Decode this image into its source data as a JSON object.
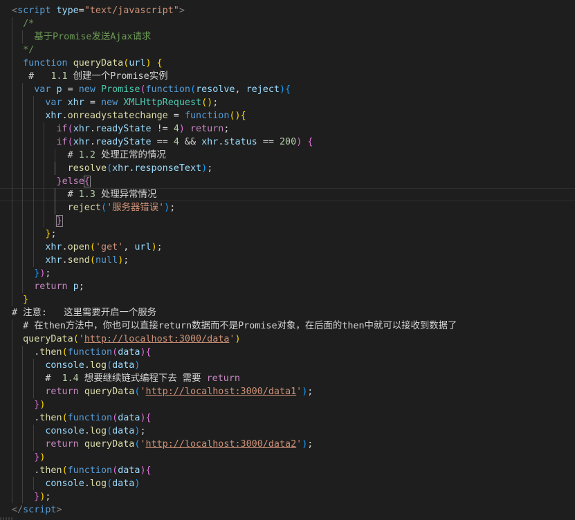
{
  "editor": {
    "colors": {
      "background": "#1e1e1e",
      "plain": "#d4d4d4",
      "keyword": "#569cd6",
      "control": "#c586c0",
      "function": "#dcdcaa",
      "variable": "#9cdcfe",
      "string": "#ce9178",
      "number": "#b5cea8",
      "comment": "#6a9955",
      "class": "#4ec9b0",
      "tag": "#569cd6",
      "tag_bracket": "#808080",
      "property": "#9cdcfe",
      "brace1": "#ffd700",
      "brace2": "#da70d6",
      "brace3": "#179fff"
    },
    "lines": [
      {
        "guides": 0,
        "tokens": [
          [
            "<",
            "tag_bracket"
          ],
          [
            "script",
            "tag"
          ],
          [
            " ",
            "plain"
          ],
          [
            "type",
            "variable"
          ],
          [
            "=",
            "plain"
          ],
          [
            "\"text/javascript\"",
            "string"
          ],
          [
            ">",
            "tag_bracket"
          ]
        ]
      },
      {
        "guides": 1,
        "tokens": [
          [
            "  /*",
            "comment"
          ]
        ]
      },
      {
        "guides": 2,
        "tokens": [
          [
            "    基于Promise发送Ajax请求",
            "comment"
          ]
        ]
      },
      {
        "guides": 1,
        "tokens": [
          [
            "  */",
            "comment"
          ]
        ]
      },
      {
        "guides": 1,
        "tokens": [
          [
            "  ",
            "plain"
          ],
          [
            "function",
            "keyword"
          ],
          [
            " ",
            "plain"
          ],
          [
            "queryData",
            "function"
          ],
          [
            "(",
            "brace1"
          ],
          [
            "url",
            "variable"
          ],
          [
            ")",
            "brace1"
          ],
          [
            " ",
            "plain"
          ],
          [
            "{",
            "brace1"
          ]
        ]
      },
      {
        "guides": 1,
        "tokens": [
          [
            "   #   ",
            "plain"
          ],
          [
            "1.1",
            "number"
          ],
          [
            " 创建一个",
            "plain"
          ],
          [
            "Promise",
            "plain"
          ],
          [
            "实例",
            "plain"
          ]
        ]
      },
      {
        "guides": 2,
        "tokens": [
          [
            "    ",
            "plain"
          ],
          [
            "var",
            "keyword"
          ],
          [
            " ",
            "plain"
          ],
          [
            "p",
            "variable"
          ],
          [
            " = ",
            "plain"
          ],
          [
            "new",
            "keyword"
          ],
          [
            " ",
            "plain"
          ],
          [
            "Promise",
            "class"
          ],
          [
            "(",
            "brace2"
          ],
          [
            "function",
            "keyword"
          ],
          [
            "(",
            "brace3"
          ],
          [
            "resolve",
            "variable"
          ],
          [
            ", ",
            "plain"
          ],
          [
            "reject",
            "variable"
          ],
          [
            ")",
            "brace3"
          ],
          [
            "{",
            "brace3"
          ]
        ]
      },
      {
        "guides": 3,
        "tokens": [
          [
            "      ",
            "plain"
          ],
          [
            "var",
            "keyword"
          ],
          [
            " ",
            "plain"
          ],
          [
            "xhr",
            "variable"
          ],
          [
            " = ",
            "plain"
          ],
          [
            "new",
            "keyword"
          ],
          [
            " ",
            "plain"
          ],
          [
            "XMLHttpRequest",
            "class"
          ],
          [
            "()",
            "brace1"
          ],
          [
            ";",
            "plain"
          ]
        ]
      },
      {
        "guides": 3,
        "tokens": [
          [
            "      ",
            "plain"
          ],
          [
            "xhr",
            "variable"
          ],
          [
            ".",
            "plain"
          ],
          [
            "onreadystatechange",
            "function"
          ],
          [
            " = ",
            "plain"
          ],
          [
            "function",
            "keyword"
          ],
          [
            "(){",
            "brace1"
          ]
        ]
      },
      {
        "guides": 4,
        "tokens": [
          [
            "        ",
            "plain"
          ],
          [
            "if",
            "control"
          ],
          [
            "(",
            "brace2"
          ],
          [
            "xhr",
            "variable"
          ],
          [
            ".",
            "plain"
          ],
          [
            "readyState",
            "property"
          ],
          [
            " != ",
            "plain"
          ],
          [
            "4",
            "number"
          ],
          [
            ")",
            "brace2"
          ],
          [
            " ",
            "plain"
          ],
          [
            "return",
            "control"
          ],
          [
            ";",
            "plain"
          ]
        ]
      },
      {
        "guides": 4,
        "tokens": [
          [
            "        ",
            "plain"
          ],
          [
            "if",
            "control"
          ],
          [
            "(",
            "brace2"
          ],
          [
            "xhr",
            "variable"
          ],
          [
            ".",
            "plain"
          ],
          [
            "readyState",
            "property"
          ],
          [
            " == ",
            "plain"
          ],
          [
            "4",
            "number"
          ],
          [
            " && ",
            "plain"
          ],
          [
            "xhr",
            "variable"
          ],
          [
            ".",
            "plain"
          ],
          [
            "status",
            "property"
          ],
          [
            " == ",
            "plain"
          ],
          [
            "200",
            "number"
          ],
          [
            ")",
            "brace2"
          ],
          [
            " ",
            "plain"
          ],
          [
            "{",
            "brace2"
          ]
        ]
      },
      {
        "guides": 5,
        "tokens": [
          [
            "          # ",
            "plain"
          ],
          [
            "1.2",
            "number"
          ],
          [
            " 处理正常的情况",
            "plain"
          ]
        ]
      },
      {
        "guides": 5,
        "tokens": [
          [
            "          ",
            "plain"
          ],
          [
            "resolve",
            "function"
          ],
          [
            "(",
            "brace3"
          ],
          [
            "xhr",
            "variable"
          ],
          [
            ".",
            "plain"
          ],
          [
            "responseText",
            "property"
          ],
          [
            ")",
            "brace3"
          ],
          [
            ";",
            "plain"
          ]
        ]
      },
      {
        "guides": 4,
        "tokens": [
          [
            "        ",
            "plain"
          ],
          [
            "}",
            "brace2"
          ],
          [
            "else",
            "control"
          ],
          [
            "{",
            "brace2",
            "box"
          ]
        ]
      },
      {
        "guides": 5,
        "current": true,
        "tokens": [
          [
            "          # ",
            "plain"
          ],
          [
            "1.3",
            "number"
          ],
          [
            " 处理异常情况",
            "plain"
          ]
        ]
      },
      {
        "guides": 5,
        "tokens": [
          [
            "          ",
            "plain"
          ],
          [
            "reject",
            "function"
          ],
          [
            "(",
            "brace3"
          ],
          [
            "'服务器错误'",
            "string"
          ],
          [
            ")",
            "brace3"
          ],
          [
            ";",
            "plain"
          ]
        ]
      },
      {
        "guides": 5,
        "tokens": [
          [
            "        ",
            "plain"
          ],
          [
            "}",
            "brace2",
            "box"
          ]
        ]
      },
      {
        "guides": 3,
        "tokens": [
          [
            "      ",
            "plain"
          ],
          [
            "}",
            "brace1"
          ],
          [
            ";",
            "plain"
          ]
        ]
      },
      {
        "guides": 3,
        "tokens": [
          [
            "      ",
            "plain"
          ],
          [
            "xhr",
            "variable"
          ],
          [
            ".",
            "plain"
          ],
          [
            "open",
            "function"
          ],
          [
            "(",
            "brace1"
          ],
          [
            "'get'",
            "string"
          ],
          [
            ", ",
            "plain"
          ],
          [
            "url",
            "variable"
          ],
          [
            ")",
            "brace1"
          ],
          [
            ";",
            "plain"
          ]
        ]
      },
      {
        "guides": 3,
        "tokens": [
          [
            "      ",
            "plain"
          ],
          [
            "xhr",
            "variable"
          ],
          [
            ".",
            "plain"
          ],
          [
            "send",
            "function"
          ],
          [
            "(",
            "brace1"
          ],
          [
            "null",
            "keyword"
          ],
          [
            ")",
            "brace1"
          ],
          [
            ";",
            "plain"
          ]
        ]
      },
      {
        "guides": 2,
        "tokens": [
          [
            "    ",
            "plain"
          ],
          [
            "}",
            "brace3"
          ],
          [
            ")",
            "brace2"
          ],
          [
            ";",
            "plain"
          ]
        ]
      },
      {
        "guides": 2,
        "tokens": [
          [
            "    ",
            "plain"
          ],
          [
            "return",
            "control"
          ],
          [
            " ",
            "plain"
          ],
          [
            "p",
            "variable"
          ],
          [
            ";",
            "plain"
          ]
        ]
      },
      {
        "guides": 1,
        "tokens": [
          [
            "  ",
            "plain"
          ],
          [
            "}",
            "brace1"
          ]
        ]
      },
      {
        "guides": 0,
        "tokens": [
          [
            "# 注意:   这里需要开启一个服务",
            "plain"
          ]
        ]
      },
      {
        "guides": 1,
        "tokens": [
          [
            "  # 在",
            "plain"
          ],
          [
            "then",
            "plain"
          ],
          [
            "方法中，你也可以直接",
            "plain"
          ],
          [
            "return",
            "plain"
          ],
          [
            "数据而不是",
            "plain"
          ],
          [
            "Promise",
            "plain"
          ],
          [
            "对象，在后面的",
            "plain"
          ],
          [
            "then",
            "plain"
          ],
          [
            "中就可以接收到数据了",
            "plain"
          ]
        ]
      },
      {
        "guides": 1,
        "tokens": [
          [
            "  ",
            "plain"
          ],
          [
            "queryData",
            "function"
          ],
          [
            "(",
            "brace1"
          ],
          [
            "'",
            "string"
          ],
          [
            "http://localhost:3000/data",
            "string",
            "link"
          ],
          [
            "'",
            "string"
          ],
          [
            ")",
            "brace1"
          ]
        ]
      },
      {
        "guides": 2,
        "tokens": [
          [
            "    .",
            "plain"
          ],
          [
            "then",
            "function"
          ],
          [
            "(",
            "brace1"
          ],
          [
            "function",
            "keyword"
          ],
          [
            "(",
            "brace2"
          ],
          [
            "data",
            "variable"
          ],
          [
            ")",
            "brace2"
          ],
          [
            "{",
            "brace2"
          ]
        ]
      },
      {
        "guides": 3,
        "tokens": [
          [
            "      ",
            "plain"
          ],
          [
            "console",
            "variable"
          ],
          [
            ".",
            "plain"
          ],
          [
            "log",
            "function"
          ],
          [
            "(",
            "brace3"
          ],
          [
            "data",
            "variable"
          ],
          [
            ")",
            "brace3"
          ]
        ]
      },
      {
        "guides": 3,
        "tokens": [
          [
            "      #  ",
            "plain"
          ],
          [
            "1.4",
            "number"
          ],
          [
            " 想要继续链式编程下去 需要 ",
            "plain"
          ],
          [
            "return",
            "control"
          ]
        ]
      },
      {
        "guides": 3,
        "tokens": [
          [
            "      ",
            "plain"
          ],
          [
            "return",
            "control"
          ],
          [
            " ",
            "plain"
          ],
          [
            "queryData",
            "function"
          ],
          [
            "(",
            "brace3"
          ],
          [
            "'",
            "string"
          ],
          [
            "http://localhost:3000/data1",
            "string",
            "link"
          ],
          [
            "'",
            "string"
          ],
          [
            ")",
            "brace3"
          ],
          [
            ";",
            "plain"
          ]
        ]
      },
      {
        "guides": 2,
        "tokens": [
          [
            "    ",
            "plain"
          ],
          [
            "}",
            "brace2"
          ],
          [
            ")",
            "brace1"
          ]
        ]
      },
      {
        "guides": 2,
        "tokens": [
          [
            "    .",
            "plain"
          ],
          [
            "then",
            "function"
          ],
          [
            "(",
            "brace1"
          ],
          [
            "function",
            "keyword"
          ],
          [
            "(",
            "brace2"
          ],
          [
            "data",
            "variable"
          ],
          [
            ")",
            "brace2"
          ],
          [
            "{",
            "brace2"
          ]
        ]
      },
      {
        "guides": 3,
        "tokens": [
          [
            "      ",
            "plain"
          ],
          [
            "console",
            "variable"
          ],
          [
            ".",
            "plain"
          ],
          [
            "log",
            "function"
          ],
          [
            "(",
            "brace3"
          ],
          [
            "data",
            "variable"
          ],
          [
            ")",
            "brace3"
          ],
          [
            ";",
            "plain"
          ]
        ]
      },
      {
        "guides": 3,
        "tokens": [
          [
            "      ",
            "plain"
          ],
          [
            "return",
            "control"
          ],
          [
            " ",
            "plain"
          ],
          [
            "queryData",
            "function"
          ],
          [
            "(",
            "brace3"
          ],
          [
            "'",
            "string"
          ],
          [
            "http://localhost:3000/data2",
            "string",
            "link"
          ],
          [
            "'",
            "string"
          ],
          [
            ")",
            "brace3"
          ],
          [
            ";",
            "plain"
          ]
        ]
      },
      {
        "guides": 2,
        "tokens": [
          [
            "    ",
            "plain"
          ],
          [
            "}",
            "brace2"
          ],
          [
            ")",
            "brace1"
          ]
        ]
      },
      {
        "guides": 2,
        "tokens": [
          [
            "    .",
            "plain"
          ],
          [
            "then",
            "function"
          ],
          [
            "(",
            "brace1"
          ],
          [
            "function",
            "keyword"
          ],
          [
            "(",
            "brace2"
          ],
          [
            "data",
            "variable"
          ],
          [
            ")",
            "brace2"
          ],
          [
            "{",
            "brace2"
          ]
        ]
      },
      {
        "guides": 3,
        "tokens": [
          [
            "      ",
            "plain"
          ],
          [
            "console",
            "variable"
          ],
          [
            ".",
            "plain"
          ],
          [
            "log",
            "function"
          ],
          [
            "(",
            "brace3"
          ],
          [
            "data",
            "variable"
          ],
          [
            ")",
            "brace3"
          ]
        ]
      },
      {
        "guides": 2,
        "tokens": [
          [
            "    ",
            "plain"
          ],
          [
            "}",
            "brace2"
          ],
          [
            ")",
            "brace1"
          ],
          [
            ";",
            "plain"
          ]
        ]
      },
      {
        "guides": 0,
        "tokens": [
          [
            "<",
            "tag_bracket"
          ],
          [
            "/",
            "tag_bracket"
          ],
          [
            "script",
            "tag"
          ],
          [
            ">",
            "tag_bracket"
          ]
        ]
      }
    ]
  }
}
